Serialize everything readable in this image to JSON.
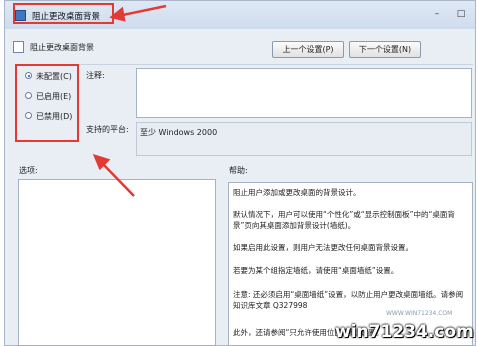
{
  "window": {
    "title": "阻止更改桌面背景",
    "minimize_glyph": "–",
    "maximize_glyph": "□",
    "close_glyph": "✕"
  },
  "header": {
    "policy_name": "阻止更改桌面背景",
    "prev_button": "上一个设置(P)",
    "next_button": "下一个设置(N)"
  },
  "state": {
    "options": [
      {
        "label": "未配置(C)",
        "selected": true
      },
      {
        "label": "已启用(E)",
        "selected": false
      },
      {
        "label": "已禁用(D)",
        "selected": false
      }
    ]
  },
  "comment": {
    "label": "注释:",
    "value": ""
  },
  "platform": {
    "label": "支持的平台:",
    "value": "至少 Windows 2000"
  },
  "sections": {
    "options_label": "选项:",
    "help_label": "帮助:"
  },
  "help": {
    "paragraphs": [
      "阻止用户添加或更改桌面的背景设计。",
      "默认情况下，用户可以使用“个性化”或“显示控制面板”中的“桌面背景”页向其桌面添加背景设计(墙纸)。",
      "如果启用此设置，则用户无法更改任何桌面背景设置。",
      "若要为某个组指定墙纸，请使用“桌面墙纸”设置。",
      "注意: 还必须启用“桌面墙纸”设置，以防止用户更改桌面墙纸。请参阅知识库文章 Q327998",
      "此外，还请参阅“只允许使用位图墙纸”设置。"
    ]
  },
  "annotation_colors": {
    "highlight": "#e33a34"
  },
  "watermark": {
    "text": "win71234.com",
    "url": "WWW.WIN71234.COM"
  }
}
